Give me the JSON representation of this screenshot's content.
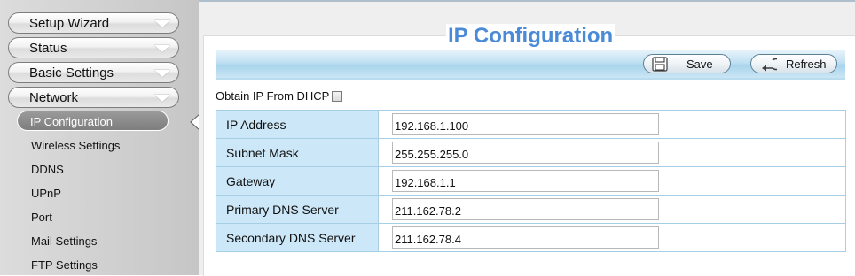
{
  "sidebar": {
    "main_items": [
      {
        "label": "Setup Wizard"
      },
      {
        "label": "Status"
      },
      {
        "label": "Basic Settings"
      },
      {
        "label": "Network"
      }
    ],
    "active_sub": "IP Configuration",
    "sub_items": [
      {
        "label": "Wireless Settings"
      },
      {
        "label": "DDNS"
      },
      {
        "label": "UPnP"
      },
      {
        "label": "Port"
      },
      {
        "label": "Mail Settings"
      },
      {
        "label": "FTP Settings"
      }
    ]
  },
  "page": {
    "title": "IP Configuration"
  },
  "toolbar": {
    "save_label": "Save",
    "refresh_label": "Refresh"
  },
  "dhcp": {
    "label": "Obtain IP From DHCP",
    "checked": false
  },
  "fields": [
    {
      "label": "IP Address",
      "value": "192.168.1.100"
    },
    {
      "label": "Subnet Mask",
      "value": "255.255.255.0"
    },
    {
      "label": "Gateway",
      "value": "192.168.1.1"
    },
    {
      "label": "Primary DNS Server",
      "value": "211.162.78.2"
    },
    {
      "label": "Secondary DNS Server",
      "value": "211.162.78.4"
    }
  ],
  "colors": {
    "title": "#4a8ad6",
    "label_cell": "#cce7f7",
    "toolbar": "#bfe0f2"
  }
}
